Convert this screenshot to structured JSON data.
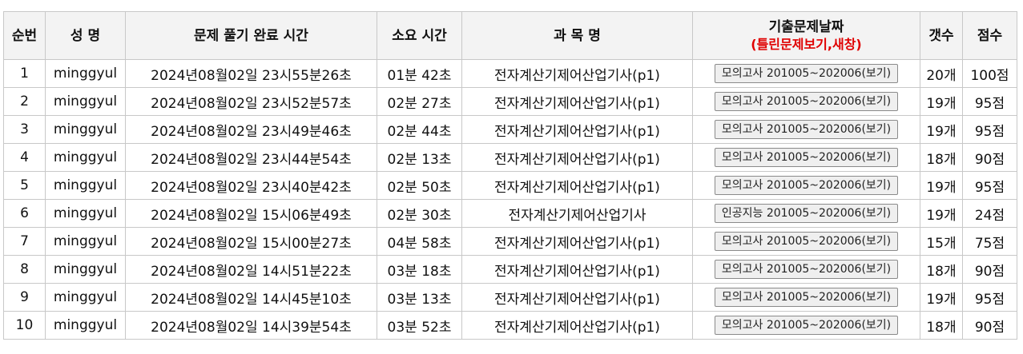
{
  "headers": {
    "no": "순번",
    "name": "성 명",
    "time": "문제 풀기 완료 시간",
    "duration": "소요 시간",
    "subject": "과 목 명",
    "exam_date": "기출문제날짜",
    "exam_date_sub": "(틀린문제보기,새창)",
    "count": "갯수",
    "score": "점수"
  },
  "rows": [
    {
      "no": "1",
      "name": "minggyul",
      "time": "2024년08월02일 23시55분26초",
      "duration": "01분 42초",
      "subject": "전자계산기제어산업기사(p1)",
      "exam_button": "모의고사 201005~202006(보기)",
      "count": "20개",
      "score": "100점"
    },
    {
      "no": "2",
      "name": "minggyul",
      "time": "2024년08월02일 23시52분57초",
      "duration": "02분 27초",
      "subject": "전자계산기제어산업기사(p1)",
      "exam_button": "모의고사 201005~202006(보기)",
      "count": "19개",
      "score": "95점"
    },
    {
      "no": "3",
      "name": "minggyul",
      "time": "2024년08월02일 23시49분46초",
      "duration": "02분 44초",
      "subject": "전자계산기제어산업기사(p1)",
      "exam_button": "모의고사 201005~202006(보기)",
      "count": "19개",
      "score": "95점"
    },
    {
      "no": "4",
      "name": "minggyul",
      "time": "2024년08월02일 23시44분54초",
      "duration": "02분 13초",
      "subject": "전자계산기제어산업기사(p1)",
      "exam_button": "모의고사 201005~202006(보기)",
      "count": "18개",
      "score": "90점"
    },
    {
      "no": "5",
      "name": "minggyul",
      "time": "2024년08월02일 23시40분42초",
      "duration": "02분 50초",
      "subject": "전자계산기제어산업기사(p1)",
      "exam_button": "모의고사 201005~202006(보기)",
      "count": "19개",
      "score": "95점"
    },
    {
      "no": "6",
      "name": "minggyul",
      "time": "2024년08월02일 15시06분49초",
      "duration": "02분 30초",
      "subject": "전자계산기제어산업기사",
      "exam_button": "인공지능 201005~202006(보기)",
      "count": "19개",
      "score": "24점"
    },
    {
      "no": "7",
      "name": "minggyul",
      "time": "2024년08월02일 15시00분27초",
      "duration": "04분 58초",
      "subject": "전자계산기제어산업기사(p1)",
      "exam_button": "모의고사 201005~202006(보기)",
      "count": "15개",
      "score": "75점"
    },
    {
      "no": "8",
      "name": "minggyul",
      "time": "2024년08월02일 14시51분22초",
      "duration": "03분 18초",
      "subject": "전자계산기제어산업기사(p1)",
      "exam_button": "모의고사 201005~202006(보기)",
      "count": "18개",
      "score": "90점"
    },
    {
      "no": "9",
      "name": "minggyul",
      "time": "2024년08월02일 14시45분10초",
      "duration": "03분 13초",
      "subject": "전자계산기제어산업기사(p1)",
      "exam_button": "모의고사 201005~202006(보기)",
      "count": "19개",
      "score": "95점"
    },
    {
      "no": "10",
      "name": "minggyul",
      "time": "2024년08월02일 14시39분54초",
      "duration": "03분 52초",
      "subject": "전자계산기제어산업기사(p1)",
      "exam_button": "모의고사 201005~202006(보기)",
      "count": "18개",
      "score": "90점"
    }
  ],
  "colors": {
    "accent_red": "#e00000",
    "header_bg": "#f3f3f3",
    "border": "#c8c8c8"
  }
}
